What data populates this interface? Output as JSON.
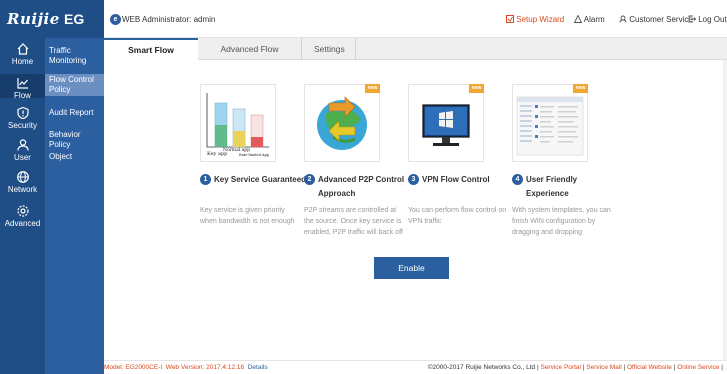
{
  "brand": {
    "logo": "Ruijie",
    "product": "EG"
  },
  "rail": [
    {
      "label": "Home",
      "icon": "home-icon"
    },
    {
      "label": "Flow",
      "icon": "chart-icon",
      "active": true
    },
    {
      "label": "Security",
      "icon": "shield-icon"
    },
    {
      "label": "User",
      "icon": "user-icon"
    },
    {
      "label": "Network",
      "icon": "globe-icon"
    },
    {
      "label": "Advanced",
      "icon": "gear-icon"
    }
  ],
  "submenu": [
    {
      "label1": "Traffic",
      "label2": "Monitoring"
    },
    {
      "label1": "Flow Control",
      "label2": "Policy",
      "active": true
    },
    {
      "label1": "Audit Report",
      "label2": ""
    },
    {
      "label1": "Behavior Policy",
      "label2": ""
    },
    {
      "label1": "Object",
      "label2": ""
    }
  ],
  "header": {
    "badge": "e",
    "user": "WEB Administrator: admin",
    "setup_wizard": "Setup Wizard",
    "alarm": "Alarm",
    "customer_service": "Customer Service",
    "logout": "Log Out"
  },
  "tabs": [
    "Smart Flow Control",
    "Advanced Flow Control",
    "Settings"
  ],
  "cards": [
    {
      "num": "1",
      "title1": "Key Service Guaranteed",
      "title2": "",
      "desc": "Key service is given priority when bandwidth is not enough",
      "new": "",
      "img_labels": [
        "Key app",
        "Normal app",
        "Rate-limited App"
      ]
    },
    {
      "num": "2",
      "title1": "Advanced P2P Control",
      "title2": "Approach",
      "desc": "P2P streams are controlled at the source. Once key service is enabled, P2P traffic will back off",
      "new": "new"
    },
    {
      "num": "3",
      "title1": "VPN Flow Control",
      "title2": "",
      "desc": "You can perform flow control on VPN traffic",
      "new": "new"
    },
    {
      "num": "4",
      "title1": "User Friendly",
      "title2": "Experience",
      "desc": "With system templates, you can finish WIN configuration by dragging and dropping",
      "new": "new"
    }
  ],
  "enable_label": "Enable",
  "footer": {
    "model": "Model: EG2000CE-I",
    "web_version": "Web Version: 2017.4.12.16",
    "details": "Details",
    "copyright": "©2000-2017 Ruijie Networks Co., Ltd",
    "links": [
      "Service Portal",
      "Service Mail",
      "Official Website",
      "Online Service"
    ]
  },
  "colors": {
    "primary": "#1f4e86",
    "accent": "#2b5fa0",
    "orange": "#f3a531",
    "red_text": "#d94a1e"
  }
}
